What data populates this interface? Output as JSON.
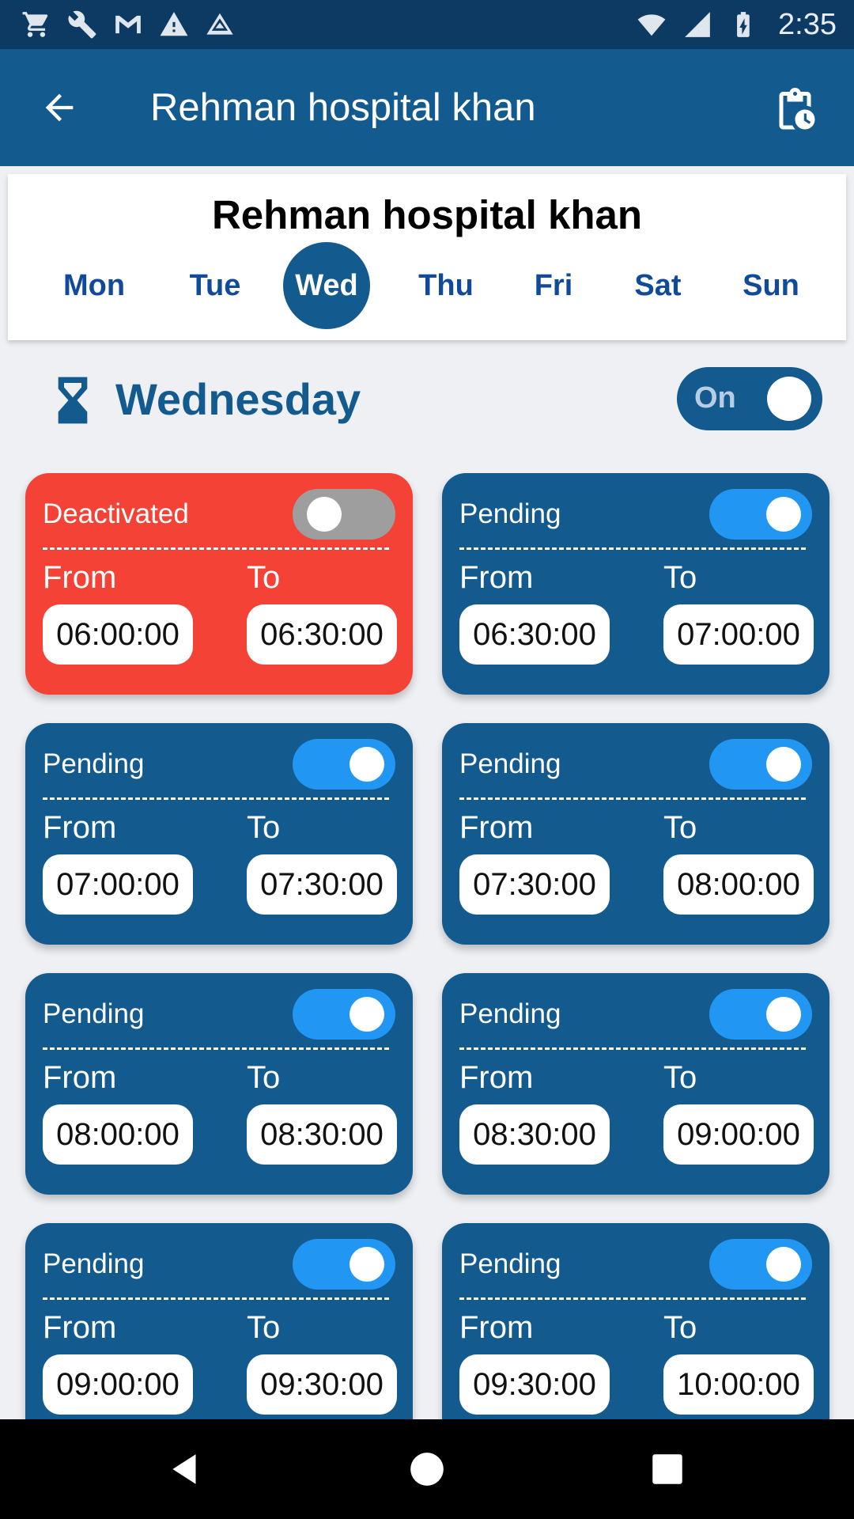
{
  "status_bar": {
    "time": "2:35",
    "left_icons": [
      "shopping-cart-icon",
      "wrench-icon",
      "gmail-icon",
      "warning-icon",
      "delta-icon"
    ],
    "right_icons": [
      "wifi-icon",
      "signal-icon",
      "battery-charging-icon"
    ]
  },
  "app_bar": {
    "title": "Rehman hospital khan",
    "back_icon": "arrow-back-icon",
    "action_icon": "clipboard-clock-icon"
  },
  "day_card": {
    "title": "Rehman hospital khan",
    "days": [
      "Mon",
      "Tue",
      "Wed",
      "Thu",
      "Fri",
      "Sat",
      "Sun"
    ],
    "selected": "Wed"
  },
  "section": {
    "title": "Wednesday",
    "toggle_label": "On",
    "toggle_on": true
  },
  "labels": {
    "from": "From",
    "to": "To"
  },
  "slots": [
    {
      "status": "Deactivated",
      "from": "06:00:00",
      "to": "06:30:00",
      "enabled": false
    },
    {
      "status": "Pending",
      "from": "06:30:00",
      "to": "07:00:00",
      "enabled": true
    },
    {
      "status": "Pending",
      "from": "07:00:00",
      "to": "07:30:00",
      "enabled": true
    },
    {
      "status": "Pending",
      "from": "07:30:00",
      "to": "08:00:00",
      "enabled": true
    },
    {
      "status": "Pending",
      "from": "08:00:00",
      "to": "08:30:00",
      "enabled": true
    },
    {
      "status": "Pending",
      "from": "08:30:00",
      "to": "09:00:00",
      "enabled": true
    },
    {
      "status": "Pending",
      "from": "09:00:00",
      "to": "09:30:00",
      "enabled": true
    },
    {
      "status": "Pending",
      "from": "09:30:00",
      "to": "10:00:00",
      "enabled": true
    }
  ],
  "colors": {
    "primary": "#135a8f",
    "status_bar": "#0d3a63",
    "deactivated": "#f44336",
    "toggle_on": "#2196f3",
    "toggle_off": "#9e9e9e",
    "day_text": "#124a9a"
  },
  "nav_bar": {
    "icons": [
      "back-triangle-icon",
      "home-circle-icon",
      "recents-square-icon"
    ]
  }
}
